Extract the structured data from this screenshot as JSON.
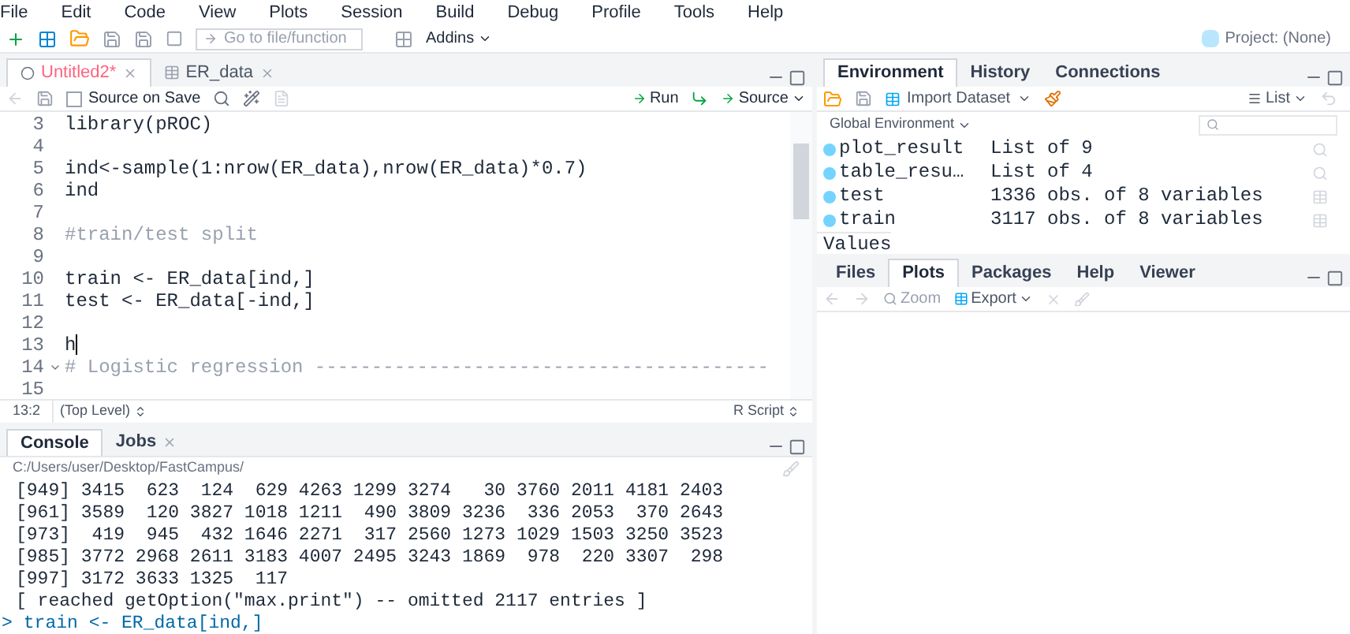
{
  "menu": [
    "File",
    "Edit",
    "Code",
    "View",
    "Plots",
    "Session",
    "Build",
    "Debug",
    "Profile",
    "Tools",
    "Help"
  ],
  "toolbar": {
    "goto_placeholder": "Go to file/function",
    "addins": "Addins",
    "project": "Project: (None)"
  },
  "source": {
    "tabs": [
      {
        "label": "Untitled2*",
        "selected": true,
        "kind": "script"
      },
      {
        "label": "ER_data",
        "selected": false,
        "kind": "data"
      }
    ],
    "source_on_save": {
      "label": "Source on Save",
      "checked": false
    },
    "run": "Run",
    "source_button": "Source",
    "lines": [
      {
        "number": "3",
        "text": "library(pROC)",
        "kind": "code"
      },
      {
        "number": "4",
        "kind": "code"
      },
      {
        "number": "5",
        "text": "ind<-sample(1:nrow(ER_data),nrow(ER_data)*0.7)",
        "kind": "code"
      },
      {
        "number": "6",
        "text": "ind",
        "kind": "code"
      },
      {
        "number": "7",
        "kind": "code"
      },
      {
        "number": "8",
        "text": "#train/test split",
        "kind": "comment"
      },
      {
        "number": "9",
        "kind": "code"
      },
      {
        "number": "10",
        "text": "train <- ER_data[ind,]",
        "kind": "code"
      },
      {
        "number": "11",
        "text": "test <- ER_data[-ind,]",
        "kind": "code"
      },
      {
        "number": "12",
        "kind": "code"
      },
      {
        "number": "13",
        "text": "h",
        "kind": "code",
        "cursor": true
      },
      {
        "number": "14",
        "text": "# Logistic regression ----------------------------------------",
        "kind": "comment",
        "fold": true
      },
      {
        "number": "15",
        "kind": "code"
      }
    ],
    "status": {
      "position": "13:2",
      "scope": "(Top Level)",
      "type": "R Script"
    }
  },
  "console": {
    "tabs": [
      {
        "label": "Console",
        "selected": true
      },
      {
        "label": "Jobs",
        "selected": false
      }
    ],
    "path": "C:/Users/user/Desktop/FastCampus/",
    "lines": [
      "[949] 3415  623  124  629 4263 1299 3274   30 3760 2011 4181 2403",
      "[961] 3589  120 3827 1018 1211  490 3809 3236  336 2053  370 2643",
      "[973]  419  945  432 1646 2271  317 2560 1273 1029 1503 3250 3523",
      "[985] 3772 2968 2611 3183 4007 2495 3243 1869  978  220 3307  298",
      "[997] 3172 3633 1325  117",
      "[ reached getOption(\"max.print\") -- omitted 2117 entries ]"
    ],
    "prompt": ">",
    "input": "train <- ER_data[ind,]"
  },
  "environment": {
    "tabs": [
      {
        "label": "Environment",
        "selected": true
      },
      {
        "label": "History",
        "selected": false
      },
      {
        "label": "Connections",
        "selected": false
      }
    ],
    "import": "Import Dataset",
    "view": "List",
    "scope": "Global Environment",
    "rows": [
      {
        "name": "plot_result",
        "value": "List of 9",
        "kind": "list"
      },
      {
        "name": "table_resu…",
        "value": "List of 4",
        "kind": "list"
      },
      {
        "name": "test",
        "value": "1336 obs. of 8 variables",
        "kind": "data"
      },
      {
        "name": "train",
        "value": "3117 obs. of 8 variables",
        "kind": "data"
      }
    ],
    "section": "Values"
  },
  "files": {
    "tabs": [
      {
        "label": "Files",
        "selected": false
      },
      {
        "label": "Plots",
        "selected": true
      },
      {
        "label": "Packages",
        "selected": false
      },
      {
        "label": "Help",
        "selected": false
      },
      {
        "label": "Viewer",
        "selected": false
      }
    ],
    "zoom": "Zoom",
    "export": "Export"
  }
}
